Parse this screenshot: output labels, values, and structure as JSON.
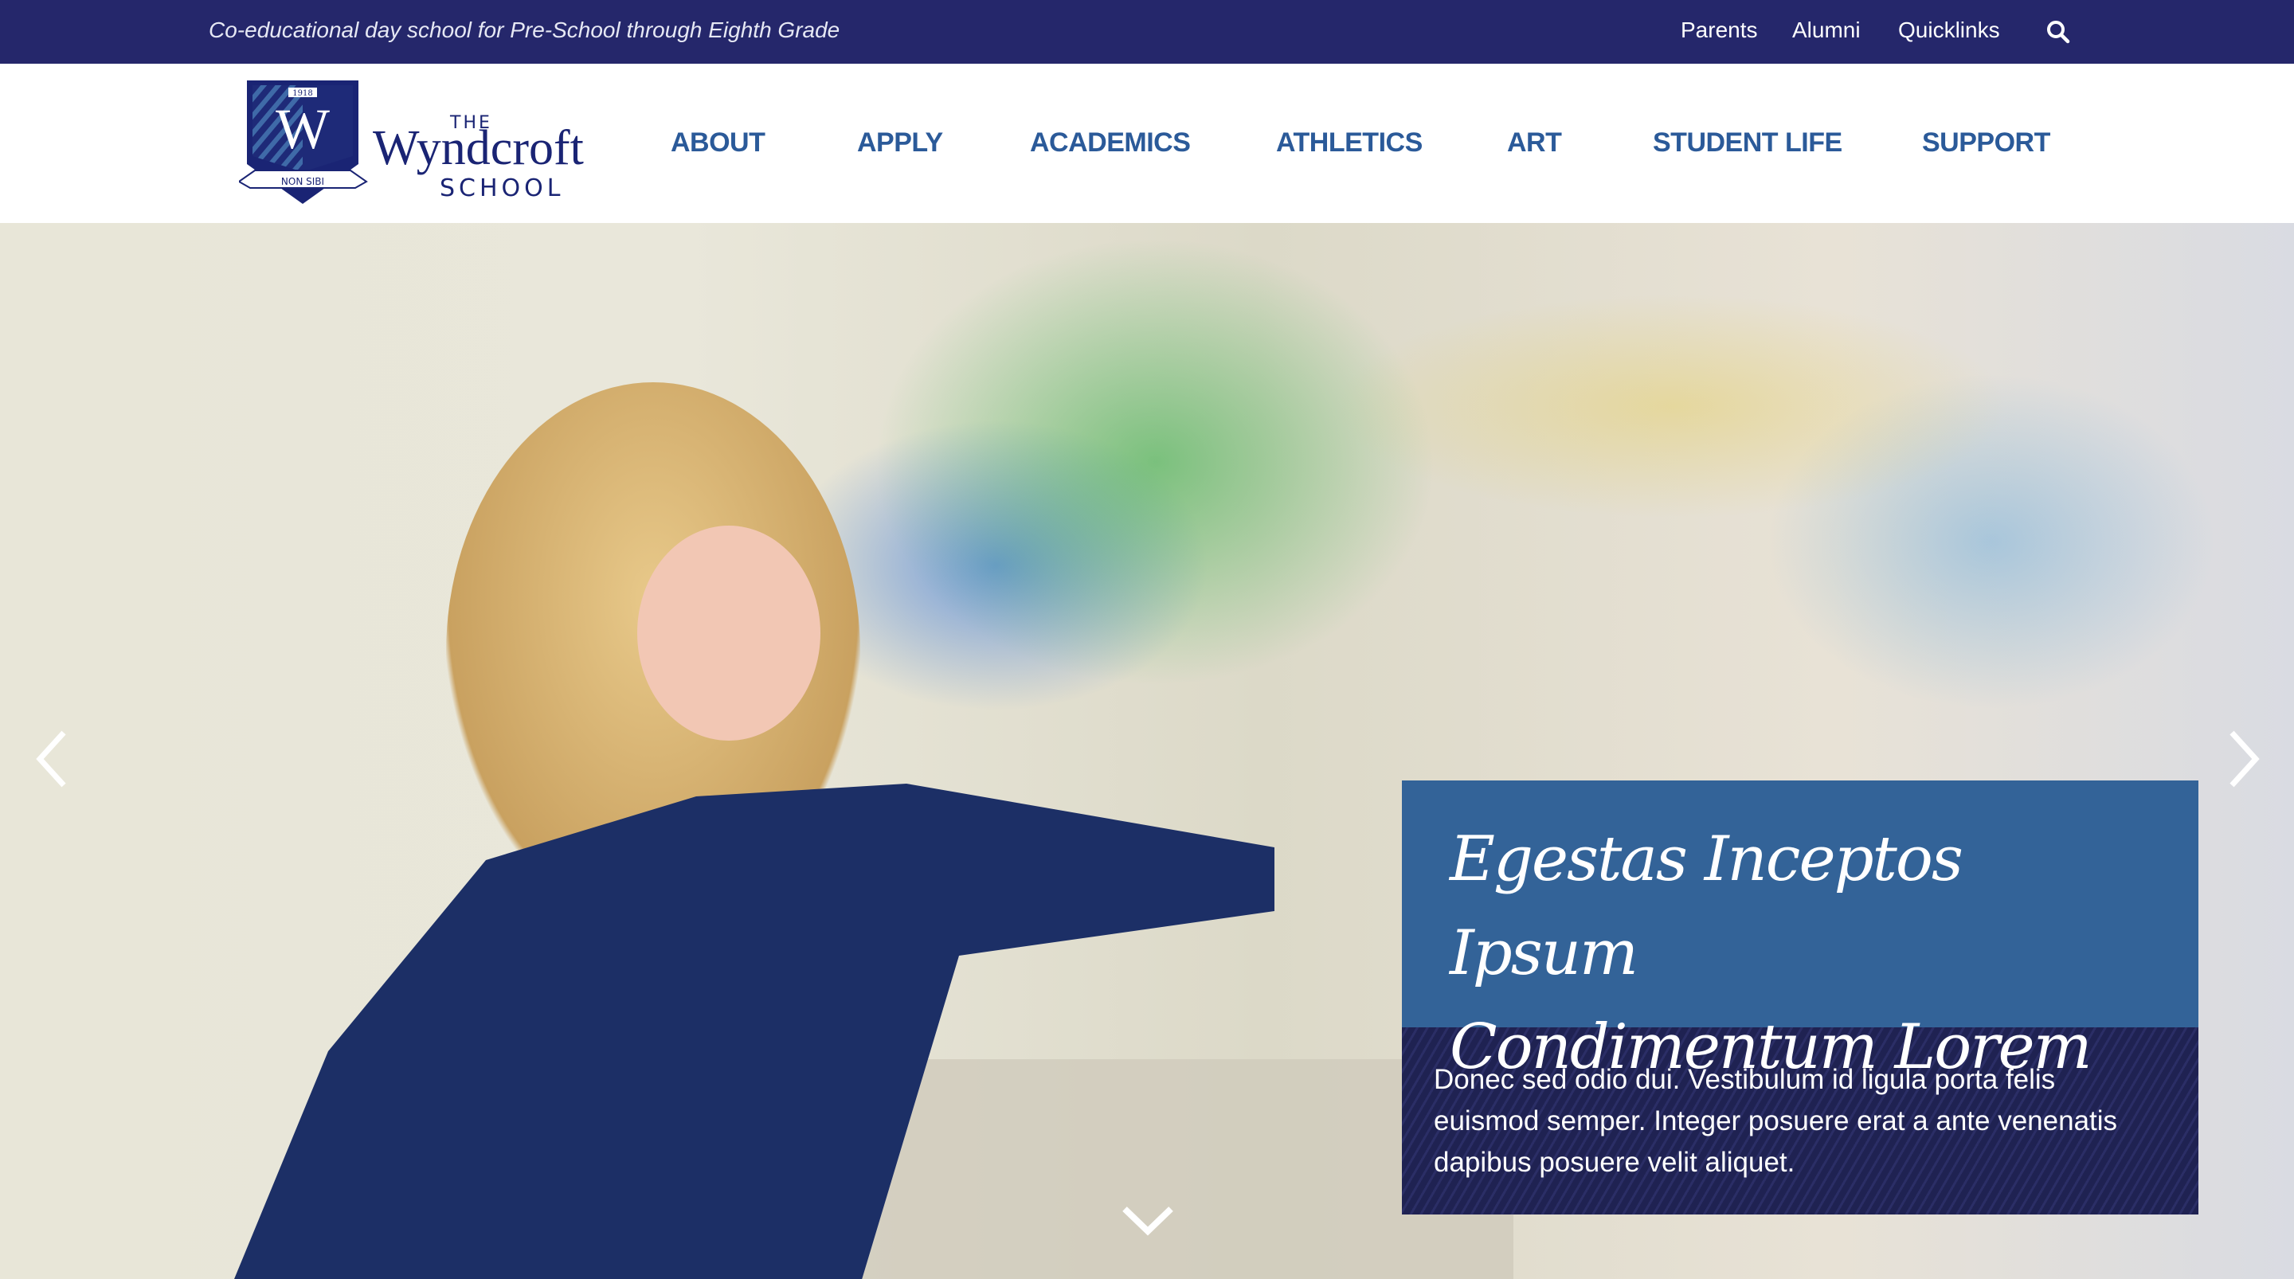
{
  "topbar": {
    "tagline": "Co-educational day school for Pre-School through Eighth Grade",
    "links": [
      "Parents",
      "Alumni",
      "Quicklinks"
    ],
    "search_icon": "search-icon"
  },
  "logo": {
    "year": "1918",
    "letter": "W",
    "motto": "NON SIBI",
    "the": "THE",
    "name": "Wyndcroft",
    "school": "SCHOOL"
  },
  "nav": [
    "ABOUT",
    "APPLY",
    "ACADEMICS",
    "ATHLETICS",
    "ART",
    "STUDENT LIFE",
    "SUPPORT"
  ],
  "hero": {
    "title_line1": "Egestas Inceptos Ipsum",
    "title_line2": "Condimentum Lorem",
    "body": "Donec sed odio dui. Vestibulum id ligula porta felis euismod semper. Integer posuere erat a ante venenatis dapibus posuere velit aliquet."
  },
  "colors": {
    "topbar": "#25276b",
    "nav": "#2b5a99",
    "card_title": "#336398",
    "card_body": "#1f2252"
  }
}
